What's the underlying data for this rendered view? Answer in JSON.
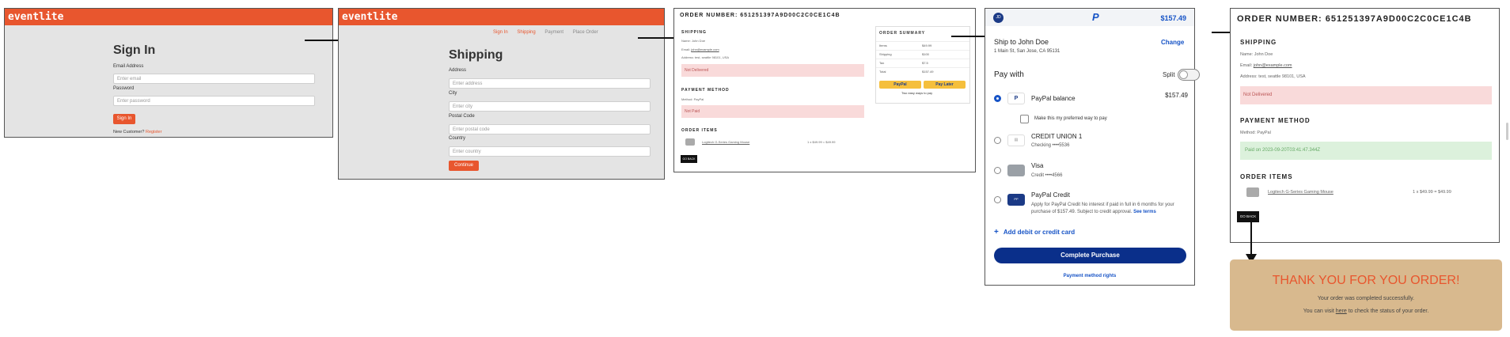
{
  "signin": {
    "brand": "eventlite",
    "title": "Sign In",
    "email_label": "Email Address",
    "email_placeholder": "Enter email",
    "password_label": "Password",
    "password_placeholder": "Enter password",
    "button": "Sign In",
    "new_customer": "New Customer?",
    "register": "Register"
  },
  "shipping": {
    "brand": "eventlite",
    "steps": [
      "Sign In",
      "Shipping",
      "Payment",
      "Place Order"
    ],
    "title": "Shipping",
    "address_label": "Address",
    "address_placeholder": "Enter address",
    "city_label": "City",
    "city_placeholder": "Enter city",
    "postal_label": "Postal Code",
    "postal_placeholder": "Enter postal code",
    "country_label": "Country",
    "country_placeholder": "Enter country",
    "button": "Continue"
  },
  "order1": {
    "order_number": "ORDER NUMBER: 651251397A9D00C2C0CE1C4B",
    "shipping_head": "SHIPPING",
    "name": "Name: John Doe",
    "email_label": "Email:",
    "email": "john@example.com",
    "address": "Address: test, seattle 98101, USA",
    "not_delivered": "Not Delivered",
    "payment_head": "PAYMENT METHOD",
    "method": "Method: PayPal",
    "not_paid": "Not Paid",
    "items_head": "ORDER ITEMS",
    "item_name": "Logitech G-Series Gaming Mouse",
    "item_price": "1 x $49.99 = $49.99",
    "go_back": "GO BACK",
    "summary": {
      "title": "ORDER SUMMARY",
      "rows": [
        {
          "label": "Items",
          "value": "$49.99"
        },
        {
          "label": "Shipping",
          "value": "$100"
        },
        {
          "label": "Tax",
          "value": "$7.5"
        },
        {
          "label": "Total",
          "value": "$157.49"
        }
      ],
      "paypal_btn": "PayPal",
      "paylater_btn": "Pay Later",
      "two_ways": "Two easy ways to pay"
    }
  },
  "paypal": {
    "avatar": "JD",
    "amount": "$157.49",
    "ship_to": "Ship to John Doe",
    "address": "1 Main St, San Jose, CA 95131",
    "change": "Change",
    "pay_with": "Pay with",
    "split": "Split",
    "options": [
      {
        "name": "PayPal balance",
        "detail": "",
        "amount": "$157.49",
        "selected": true
      },
      {
        "name": "CREDIT UNION 1",
        "detail": "Checking ••••5536",
        "amount": "",
        "selected": false
      },
      {
        "name": "Visa",
        "detail": "Credit ••••4566",
        "amount": "",
        "selected": false
      },
      {
        "name": "PayPal Credit",
        "detail": "Apply for PayPal Credit No interest if paid in full in 6 months for your purchase of $157.49. Subject to credit approval.",
        "amount": "",
        "selected": false
      }
    ],
    "see_terms": "See terms",
    "preferred": "Make this my preferred way to pay",
    "add_card": "Add debit or credit card",
    "complete": "Complete Purchase",
    "rights": "Payment method rights",
    "colors": {
      "brand_blue": "#003087",
      "link_blue": "#1653c6"
    }
  },
  "order2": {
    "order_number": "ORDER NUMBER: 651251397A9D00C2C0CE1C4B",
    "shipping_head": "SHIPPING",
    "name": "Name: John Doe",
    "email_label": "Email:",
    "email": "john@example.com",
    "address": "Address: test, seattle 98101, USA",
    "not_delivered": "Not Delivered",
    "payment_head": "PAYMENT METHOD",
    "method": "Method: PayPal",
    "paid_on": "Paid on 2023-09-20T03:41:47.344Z",
    "items_head": "ORDER ITEMS",
    "item_name": "Logitech G-Series Gaming Mouse",
    "item_price": "1 x $49.99 = $49.99",
    "go_back": "GO BACK"
  },
  "thanks": {
    "title": "THANK YOU FOR YOU ORDER!",
    "line1": "Your order was completed successfully.",
    "line2_pre": "You can visit",
    "here": "here",
    "line2_post": "to check the status of your order."
  },
  "colors": {
    "accent": "#e8562e",
    "tan": "#d8b98e",
    "arrow": "#111111"
  }
}
